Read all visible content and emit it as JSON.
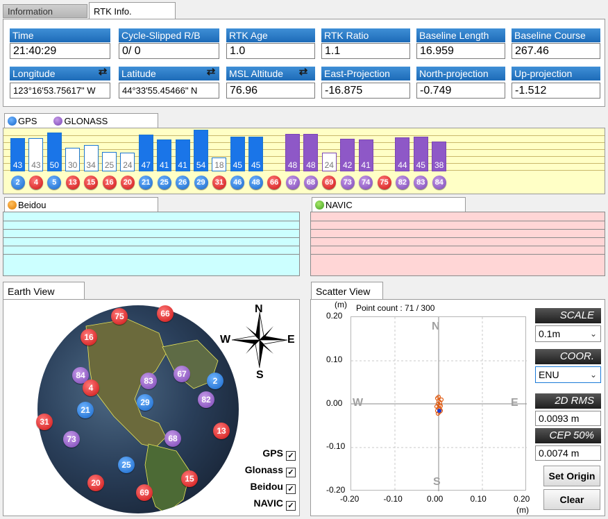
{
  "tabs": {
    "information": "Information",
    "rtk_info": "RTK  Info."
  },
  "fields_row1": [
    {
      "label": "Time",
      "value": "21:40:29"
    },
    {
      "label": "Cycle-Slipped R/B",
      "value": "  0/    0"
    },
    {
      "label": "RTK  Age",
      "value": "1.0"
    },
    {
      "label": "RTK  Ratio",
      "value": "1.1"
    },
    {
      "label": "Baseline  Length",
      "value": "16.959"
    },
    {
      "label": "Baseline  Course",
      "value": "267.46"
    }
  ],
  "fields_row2": [
    {
      "label": "Longitude",
      "value": "123°16'53.75617\" W"
    },
    {
      "label": "Latitude",
      "value": "44°33'55.45466\" N"
    },
    {
      "label": "MSL Altitude",
      "value": "76.96"
    },
    {
      "label": "East-Projection",
      "value": "-16.875"
    },
    {
      "label": "North-projection",
      "value": "-0.749"
    },
    {
      "label": "Up-projection",
      "value": "-1.512"
    }
  ],
  "constellations": {
    "gps": "GPS",
    "glonass": "GLONASS",
    "beidou": "Beidou",
    "navic": "NAVIC"
  },
  "colors": {
    "gps": "#1a75e8",
    "glonass": "#8e58c7",
    "inactive": "#e02424",
    "beidou_bg": "#ccffff",
    "navic_bg": "#ffd6d6",
    "sat_bg": "#ffffc6"
  },
  "satellites": [
    {
      "id": "2",
      "snr": 43,
      "used": true,
      "sys": "gps"
    },
    {
      "id": "4",
      "snr": 43,
      "used": false,
      "sys": "gps"
    },
    {
      "id": "5",
      "snr": 50,
      "used": true,
      "sys": "gps"
    },
    {
      "id": "13",
      "snr": 30,
      "used": false,
      "sys": "gps"
    },
    {
      "id": "15",
      "snr": 34,
      "used": false,
      "sys": "gps"
    },
    {
      "id": "16",
      "snr": 25,
      "used": false,
      "sys": "gps"
    },
    {
      "id": "20",
      "snr": 24,
      "used": false,
      "sys": "gps"
    },
    {
      "id": "21",
      "snr": 47,
      "used": true,
      "sys": "gps"
    },
    {
      "id": "25",
      "snr": 41,
      "used": true,
      "sys": "gps"
    },
    {
      "id": "26",
      "snr": 41,
      "used": true,
      "sys": "gps"
    },
    {
      "id": "29",
      "snr": 54,
      "used": true,
      "sys": "gps"
    },
    {
      "id": "31",
      "snr": 18,
      "used": false,
      "sys": "gps"
    },
    {
      "id": "46",
      "snr": 45,
      "used": true,
      "sys": "gps"
    },
    {
      "id": "48",
      "snr": 45,
      "used": true,
      "sys": "gps"
    },
    {
      "id": "66",
      "snr": null,
      "used": false,
      "sys": "glonass"
    },
    {
      "id": "67",
      "snr": 48,
      "used": true,
      "sys": "glonass"
    },
    {
      "id": "68",
      "snr": 48,
      "used": true,
      "sys": "glonass"
    },
    {
      "id": "69",
      "snr": 24,
      "used": false,
      "sys": "glonass"
    },
    {
      "id": "73",
      "snr": 42,
      "used": true,
      "sys": "glonass"
    },
    {
      "id": "74",
      "snr": 41,
      "used": true,
      "sys": "glonass"
    },
    {
      "id": "75",
      "snr": null,
      "used": false,
      "sys": "glonass"
    },
    {
      "id": "82",
      "snr": 44,
      "used": true,
      "sys": "glonass"
    },
    {
      "id": "83",
      "snr": 45,
      "used": true,
      "sys": "glonass"
    },
    {
      "id": "84",
      "snr": 38,
      "used": true,
      "sys": "glonass"
    }
  ],
  "earth_view": {
    "title": "Earth View",
    "compass": {
      "n": "N",
      "s": "S",
      "e": "E",
      "w": "W"
    },
    "checkboxes": [
      {
        "label": "GPS",
        "checked": true
      },
      {
        "label": "Glonass",
        "checked": true
      },
      {
        "label": "Beidou",
        "checked": true
      },
      {
        "label": "NAVIC",
        "checked": true
      }
    ],
    "markers": [
      "75",
      "66",
      "16",
      "84",
      "4",
      "83",
      "67",
      "2",
      "29",
      "21",
      "82",
      "31",
      "73",
      "68",
      "13",
      "25",
      "20",
      "69",
      "15"
    ]
  },
  "scatter_view": {
    "title": "Scatter View",
    "unit": "(m)",
    "point_count": "Point count : 71 / 300",
    "y_ticks": [
      "0.20",
      "0.10",
      "0.00",
      "-0.10",
      "-0.20"
    ],
    "x_ticks": [
      "-0.20",
      "-0.10",
      "0.00",
      "0.10",
      "0.20"
    ],
    "compass": {
      "n": "N",
      "s": "S",
      "e": "E",
      "w": "W"
    },
    "scale_label": "SCALE",
    "scale_value": "0.1m",
    "coor_label": "COOR.",
    "coor_value": "ENU",
    "rms_label": "2D RMS",
    "rms_value": "0.0093 m",
    "cep_label": "CEP 50%",
    "cep_value": "0.0074 m",
    "set_origin": "Set Origin",
    "clear": "Clear"
  }
}
